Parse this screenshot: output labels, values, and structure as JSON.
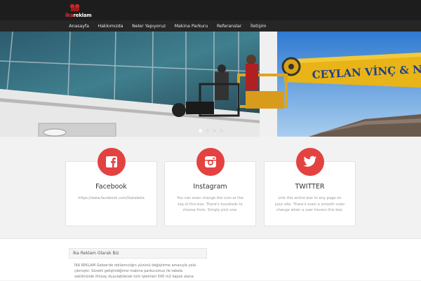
{
  "logo": {
    "prefix": "İka",
    "suffix": "reklam"
  },
  "nav": {
    "items": [
      "Anasayfa",
      "Hakkımızda",
      "Neler Yapıyoruz",
      "Makina Parkuru",
      "Referanslar",
      "İletişim"
    ]
  },
  "hero": {
    "crane_text": "CEYLAN VİNÇ & N",
    "slide_count": 4,
    "active_slide": 1
  },
  "cards": [
    {
      "title": "Facebook",
      "text": "https://www.facebook.com/ikatabela",
      "icon": "facebook-icon"
    },
    {
      "title": "Instagram",
      "text": "You can even change the icon at the top of this box. There's hundreds to choose from. Simply pick one.",
      "icon": "instagram-icon"
    },
    {
      "title": "TWITTER",
      "text": "Link this entire box to any page on your site. There's even a smooth color change when a user hovers this box.",
      "icon": "twitter-icon"
    }
  ],
  "about": {
    "title": "İka Reklam Olarak Biz",
    "body": "İKA REKLAM Gebze'de reklamcılığın yüzünü değiştirme amacıyla yola çıkmıştır. Sürekli geliştirdiğimiz makine parkurumuz ile tabela sektöründe ihtiyaç duyulabilecek tüm işlemleri 500 m2 kapalı alana"
  },
  "colors": {
    "accent": "#e44141",
    "topbar": "#1d1d1d",
    "navbar": "#262626"
  }
}
